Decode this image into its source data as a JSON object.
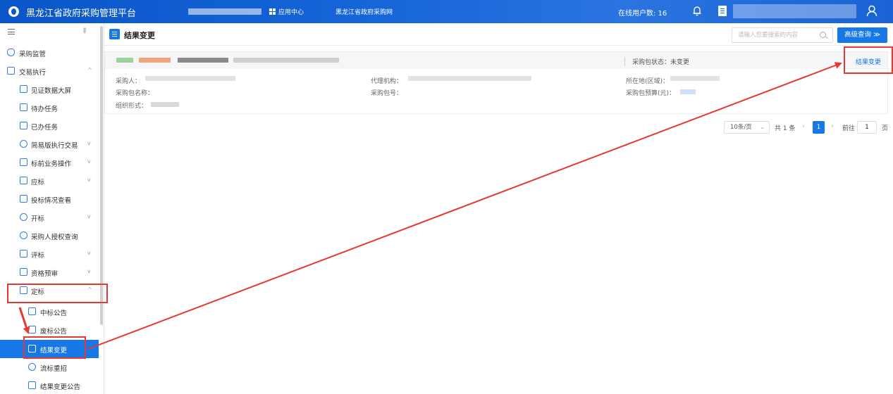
{
  "header": {
    "app_title": "黑龙江省政府采购管理平台",
    "app_center": "应用中心",
    "gov_site": "黑龙江省政府采购网",
    "online_users_label": "在线用户数: 16"
  },
  "sidebar": {
    "items": [
      {
        "label": "采购监管",
        "icon": "shield-icon"
      },
      {
        "label": "交易执行",
        "icon": "transaction-icon",
        "chevron": "^"
      },
      {
        "label": "见证数据大屏",
        "icon": "screen-icon"
      },
      {
        "label": "待办任务",
        "icon": "todo-icon"
      },
      {
        "label": "已办任务",
        "icon": "done-icon"
      },
      {
        "label": "简易版执行交易",
        "icon": "simple-trade-icon",
        "chevron": "v"
      },
      {
        "label": "标前业务操作",
        "icon": "cart-icon",
        "chevron": "v"
      },
      {
        "label": "应标",
        "icon": "bid-icon",
        "chevron": "v"
      },
      {
        "label": "投标情况查看",
        "icon": "bid-view-icon"
      },
      {
        "label": "开标",
        "icon": "open-bid-icon",
        "chevron": "v"
      },
      {
        "label": "采购人授权查询",
        "icon": "auth-query-icon"
      },
      {
        "label": "评标",
        "icon": "evaluate-icon",
        "chevron": "v"
      },
      {
        "label": "资格预审",
        "icon": "prequalify-icon",
        "chevron": "v"
      },
      {
        "label": "定标",
        "icon": "award-icon",
        "chevron": "^"
      },
      {
        "label": "中标公告",
        "icon": "notice-icon"
      },
      {
        "label": "废标公告",
        "icon": "notice-icon"
      },
      {
        "label": "结果变更",
        "icon": "result-change-icon"
      },
      {
        "label": "流标重招",
        "icon": "rebid-icon"
      },
      {
        "label": "结果变更公告",
        "icon": "notice-icon"
      }
    ]
  },
  "main": {
    "title": "结果变更",
    "search_placeholder": "请输入您要搜索的内容",
    "advanced_search": "高级查询 ≫",
    "card": {
      "package_status": "采购包状态：未变更",
      "action_link": "结果变更",
      "fields": {
        "purchaser": "采购人：",
        "agency": "代理机构：",
        "region": "所在地(区域)：",
        "package_name": "采购包名称：",
        "package_no": "采购包号：",
        "budget": "采购包预算(元)：",
        "org_form": "组织形式："
      }
    },
    "pagination": {
      "page_size": "10条/页",
      "total": "共 1 条",
      "current": "1",
      "goto_label": "前往",
      "goto_value": "1",
      "goto_suffix": "页"
    }
  },
  "colors": {
    "primary": "#1677e6",
    "topbar": "#0a56c9",
    "annotation": "#e53935"
  }
}
